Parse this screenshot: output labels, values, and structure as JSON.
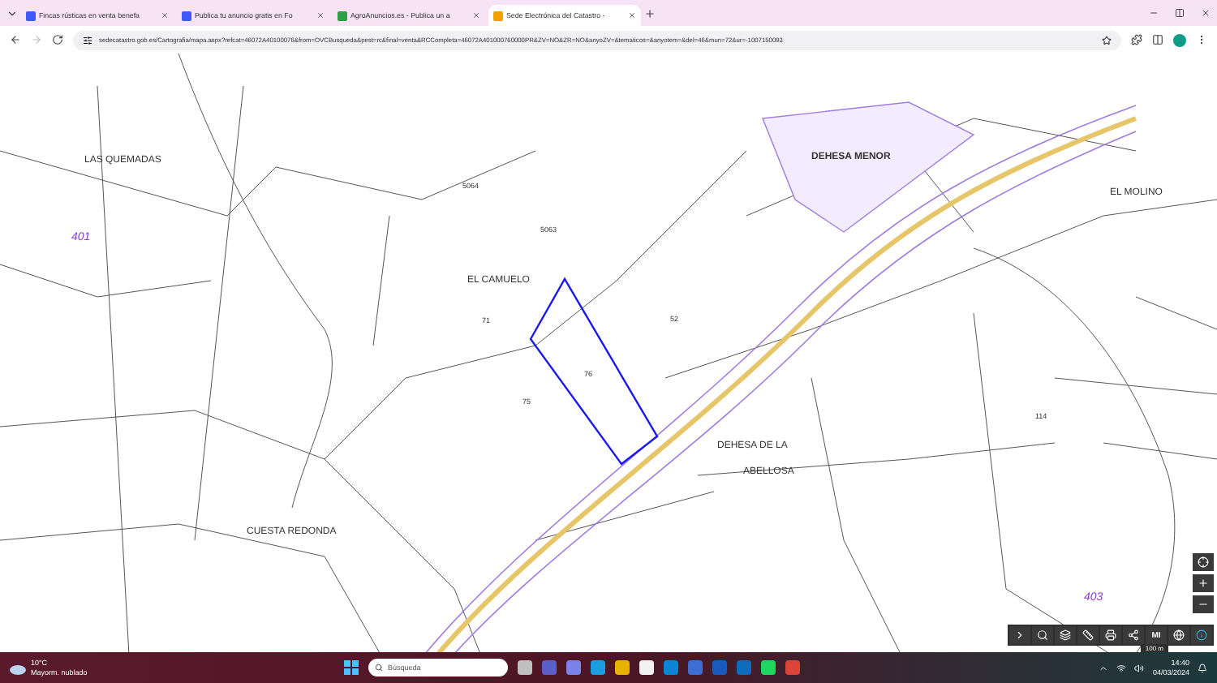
{
  "tabs": [
    {
      "title": "Fincas rústicas en venta benefa",
      "selected": false
    },
    {
      "title": "Publica tu anuncio gratis en Fo",
      "selected": false
    },
    {
      "title": "AgroAnuncios.es - Publica un a",
      "selected": false
    },
    {
      "title": "Sede Electrónica del Catastro -",
      "selected": true
    }
  ],
  "address": {
    "url": "sedecatastro.gob.es/Cartografia/mapa.aspx?refcat=46072A40100076&from=OVCBusqueda&pest=rc&final=venta&RCCompleta=46072A401000760000PR&ZV=NO&ZR=NO&anyoZV=&tematicos=&anyotem=&del=46&mun=72&ur=-1007150093"
  },
  "map": {
    "labels": [
      {
        "text": "LAS QUEMADAS",
        "kind": "place"
      },
      {
        "text": "EL CAMUELO",
        "kind": "place"
      },
      {
        "text": "DEHESA MENOR",
        "kind": "place"
      },
      {
        "text": "EL MOLINO",
        "kind": "place"
      },
      {
        "text": "CUESTA REDONDA",
        "kind": "place"
      },
      {
        "text": "DEHESA DE LA",
        "kind": "place"
      },
      {
        "text": "ABELLOSA",
        "kind": "place"
      },
      {
        "text": "401",
        "kind": "polygon"
      },
      {
        "text": "403",
        "kind": "polygon"
      },
      {
        "text": "76",
        "kind": "parcel"
      },
      {
        "text": "71",
        "kind": "parcel"
      },
      {
        "text": "75",
        "kind": "parcel"
      },
      {
        "text": "52",
        "kind": "parcel"
      },
      {
        "text": "114",
        "kind": "parcel"
      },
      {
        "text": "5064",
        "kind": "parcel"
      },
      {
        "text": "5063",
        "kind": "parcel"
      }
    ],
    "scale": "100 m",
    "toolbar_text": "MI"
  },
  "taskbar": {
    "weather_temp": "10°C",
    "weather_text": "Mayorm. nublado",
    "search_placeholder": "Búsqueda",
    "time": "14:40",
    "date": "04/03/2024"
  }
}
